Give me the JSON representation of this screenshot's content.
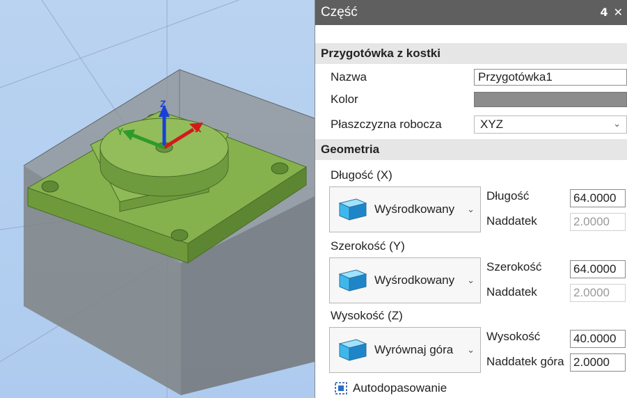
{
  "panel": {
    "title": "Część",
    "pin_icon": "pin-icon",
    "close_icon": "close-icon",
    "section_stock": "Przygotówka z kostki",
    "name_label": "Nazwa",
    "name_value": "Przygotówka1",
    "color_label": "Kolor",
    "color_value": "#8c8c8c",
    "plane_label": "Płaszczyzna robocza",
    "plane_value": "XYZ",
    "section_geometry": "Geometria",
    "length_group": "Długość (X)",
    "length_mode": "Wyśrodkowany",
    "length_label": "Długość",
    "length_value": "64.0000",
    "length_allow_label": "Naddatek",
    "length_allow_value": "2.0000",
    "width_group": "Szerokość (Y)",
    "width_mode": "Wyśrodkowany",
    "width_label": "Szerokość",
    "width_value": "64.0000",
    "width_allow_label": "Naddatek",
    "width_allow_value": "2.0000",
    "height_group": "Wysokość (Z)",
    "height_mode": "Wyrównaj góra",
    "height_label": "Wysokość",
    "height_value": "40.0000",
    "height_allow_label": "Naddatek góra",
    "height_allow_value": "2.0000",
    "autofit_label": "Autodopasowanie"
  },
  "viewport": {
    "axis_x": "X",
    "axis_y": "Y",
    "axis_z": "Z",
    "part_color": "#7fa84a",
    "stock_color": "#8e9092"
  }
}
